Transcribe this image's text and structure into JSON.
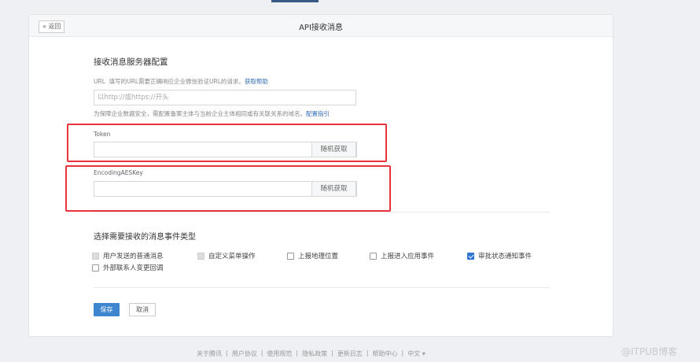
{
  "header": {
    "back_label": "« 返回",
    "title": "API接收消息"
  },
  "server": {
    "title": "接收消息服务器配置",
    "url_label": "URL",
    "url_hint": "填写的URL需要正确响应企业微信验证URL的请求。",
    "url_help_link": "获取帮助",
    "url_placeholder": "以http://或https://开头",
    "domain_hint": "为保障企业数据安全，需配置备案主体与当前企业主体相同或有关联关系的域名。",
    "domain_link": "配置指引"
  },
  "token": {
    "label": "Token",
    "value": "",
    "random_button": "随机获取"
  },
  "aeskey": {
    "label": "EncodingAESKey",
    "value": "",
    "random_button": "随机获取"
  },
  "events": {
    "title": "选择需要接收的消息事件类型",
    "items": [
      {
        "label": "用户发送的普通消息",
        "state": "disabled-checked"
      },
      {
        "label": "自定义菜单操作",
        "state": "disabled-checked"
      },
      {
        "label": "上报地理位置",
        "state": "unchecked"
      },
      {
        "label": "上报进入应用事件",
        "state": "unchecked"
      },
      {
        "label": "审批状态通知事件",
        "state": "checked"
      },
      {
        "label": "外部联系人变更回调",
        "state": "unchecked"
      }
    ]
  },
  "actions": {
    "save": "保存",
    "cancel": "取消"
  },
  "footer": {
    "links": [
      "关于腾讯",
      "用户协议",
      "使用规范",
      "隐私政策",
      "更新日志",
      "帮助中心"
    ],
    "language": "中文 ▾"
  },
  "watermark": "@ITPUB博客"
}
